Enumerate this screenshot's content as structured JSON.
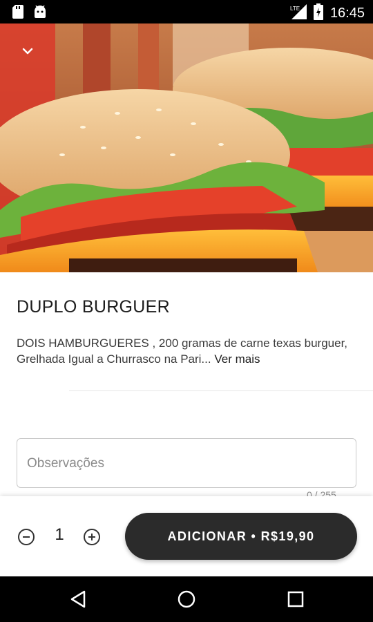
{
  "status_bar": {
    "time": "16:45",
    "network": "LTE",
    "icons": [
      "sd-card-icon",
      "android-icon",
      "signal-icon",
      "battery-icon"
    ]
  },
  "hero": {
    "image": "burger-photo",
    "collapse_icon": "chevron-down-icon"
  },
  "product": {
    "title": "DUPLO BURGUER",
    "description": " DOIS HAMBURGUERES , 200 gramas de carne texas burguer, Grelhada Igual a Churrasco na Pari...",
    "more_link": "Ver mais"
  },
  "notes": {
    "placeholder": "Observações",
    "value": "",
    "counter": "0 / 255"
  },
  "order": {
    "quantity": "1",
    "add_button_label": "ADICIONAR • R$19,90"
  },
  "navigation": {
    "icons": [
      "back-icon",
      "home-icon",
      "recent-apps-icon"
    ]
  },
  "colors": {
    "button_dark": "#2b2b2b",
    "text_primary": "#1d1d1d",
    "border": "#c9c9c9"
  }
}
